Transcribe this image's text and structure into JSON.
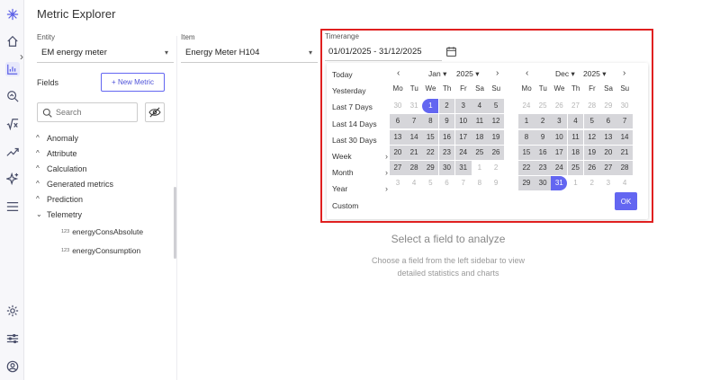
{
  "app": {
    "title": "Metric Explorer"
  },
  "entity": {
    "label": "Entity",
    "value": "EM energy meter"
  },
  "item": {
    "label": "Item",
    "value": "Energy Meter H104"
  },
  "fields": {
    "title": "Fields",
    "new_metric_label": "+ New Metric",
    "search_placeholder": "Search",
    "groups": [
      {
        "label": "Anomaly"
      },
      {
        "label": "Attribute"
      },
      {
        "label": "Calculation"
      },
      {
        "label": "Generated metrics"
      },
      {
        "label": "Prediction"
      },
      {
        "label": "Telemetry"
      }
    ],
    "telemetry_children": [
      {
        "prefix": "123",
        "label": "energyConsAbsolute"
      },
      {
        "prefix": "123",
        "label": "energyConsumption"
      }
    ]
  },
  "empty_state": {
    "title": "Select a field to analyze",
    "subtitle_line1": "Choose a field from the left sidebar to view",
    "subtitle_line2": "detailed statistics and charts"
  },
  "timerange": {
    "label": "Timerange",
    "value": "01/01/2025 - 31/12/2025",
    "presets": [
      {
        "label": "Today",
        "has_arrow": false
      },
      {
        "label": "Yesterday",
        "has_arrow": false
      },
      {
        "label": "Last 7 Days",
        "has_arrow": false
      },
      {
        "label": "Last 14 Days",
        "has_arrow": false
      },
      {
        "label": "Last 30 Days",
        "has_arrow": false
      },
      {
        "label": "Week",
        "has_arrow": true
      },
      {
        "label": "Month",
        "has_arrow": true
      },
      {
        "label": "Year",
        "has_arrow": true
      },
      {
        "label": "Custom",
        "has_arrow": false
      }
    ],
    "weekdays": [
      "Mo",
      "Tu",
      "We",
      "Th",
      "Fr",
      "Sa",
      "Su"
    ],
    "months": [
      {
        "month": "Jan",
        "year": "2025",
        "days": [
          {
            "d": "30",
            "s": "out"
          },
          {
            "d": "31",
            "s": "out"
          },
          {
            "d": "1",
            "s": "start"
          },
          {
            "d": "2",
            "s": "in"
          },
          {
            "d": "3",
            "s": "in"
          },
          {
            "d": "4",
            "s": "in"
          },
          {
            "d": "5",
            "s": "in"
          },
          {
            "d": "6",
            "s": "in"
          },
          {
            "d": "7",
            "s": "in"
          },
          {
            "d": "8",
            "s": "in"
          },
          {
            "d": "9",
            "s": "in"
          },
          {
            "d": "10",
            "s": "in"
          },
          {
            "d": "11",
            "s": "in"
          },
          {
            "d": "12",
            "s": "in"
          },
          {
            "d": "13",
            "s": "in"
          },
          {
            "d": "14",
            "s": "in"
          },
          {
            "d": "15",
            "s": "in"
          },
          {
            "d": "16",
            "s": "in"
          },
          {
            "d": "17",
            "s": "in"
          },
          {
            "d": "18",
            "s": "in"
          },
          {
            "d": "19",
            "s": "in"
          },
          {
            "d": "20",
            "s": "in"
          },
          {
            "d": "21",
            "s": "in"
          },
          {
            "d": "22",
            "s": "in"
          },
          {
            "d": "23",
            "s": "in"
          },
          {
            "d": "24",
            "s": "in"
          },
          {
            "d": "25",
            "s": "in"
          },
          {
            "d": "26",
            "s": "in"
          },
          {
            "d": "27",
            "s": "in"
          },
          {
            "d": "28",
            "s": "in"
          },
          {
            "d": "29",
            "s": "in"
          },
          {
            "d": "30",
            "s": "in"
          },
          {
            "d": "31",
            "s": "in"
          },
          {
            "d": "1",
            "s": "out"
          },
          {
            "d": "2",
            "s": "out"
          },
          {
            "d": "3",
            "s": "out"
          },
          {
            "d": "4",
            "s": "out"
          },
          {
            "d": "5",
            "s": "out"
          },
          {
            "d": "6",
            "s": "out"
          },
          {
            "d": "7",
            "s": "out"
          },
          {
            "d": "8",
            "s": "out"
          },
          {
            "d": "9",
            "s": "out"
          }
        ]
      },
      {
        "month": "Dec",
        "year": "2025",
        "days": [
          {
            "d": "24",
            "s": "out"
          },
          {
            "d": "25",
            "s": "out"
          },
          {
            "d": "26",
            "s": "out"
          },
          {
            "d": "27",
            "s": "out"
          },
          {
            "d": "28",
            "s": "out"
          },
          {
            "d": "29",
            "s": "out"
          },
          {
            "d": "30",
            "s": "out"
          },
          {
            "d": "1",
            "s": "in"
          },
          {
            "d": "2",
            "s": "in"
          },
          {
            "d": "3",
            "s": "in"
          },
          {
            "d": "4",
            "s": "in"
          },
          {
            "d": "5",
            "s": "in"
          },
          {
            "d": "6",
            "s": "in"
          },
          {
            "d": "7",
            "s": "in"
          },
          {
            "d": "8",
            "s": "in"
          },
          {
            "d": "9",
            "s": "in"
          },
          {
            "d": "10",
            "s": "in"
          },
          {
            "d": "11",
            "s": "in"
          },
          {
            "d": "12",
            "s": "in"
          },
          {
            "d": "13",
            "s": "in"
          },
          {
            "d": "14",
            "s": "in"
          },
          {
            "d": "15",
            "s": "in"
          },
          {
            "d": "16",
            "s": "in"
          },
          {
            "d": "17",
            "s": "in"
          },
          {
            "d": "18",
            "s": "in"
          },
          {
            "d": "19",
            "s": "in"
          },
          {
            "d": "20",
            "s": "in"
          },
          {
            "d": "21",
            "s": "in"
          },
          {
            "d": "22",
            "s": "in"
          },
          {
            "d": "23",
            "s": "in"
          },
          {
            "d": "24",
            "s": "in"
          },
          {
            "d": "25",
            "s": "in"
          },
          {
            "d": "26",
            "s": "in"
          },
          {
            "d": "27",
            "s": "in"
          },
          {
            "d": "28",
            "s": "in"
          },
          {
            "d": "29",
            "s": "in"
          },
          {
            "d": "30",
            "s": "in"
          },
          {
            "d": "31",
            "s": "end"
          },
          {
            "d": "1",
            "s": "out"
          },
          {
            "d": "2",
            "s": "out"
          },
          {
            "d": "3",
            "s": "out"
          },
          {
            "d": "4",
            "s": "out"
          }
        ]
      }
    ],
    "ok_label": "OK"
  },
  "colors": {
    "accent": "#6366f1",
    "range_fill": "#d6d6da",
    "highlight": "#e02020"
  },
  "rail_icons": [
    "logo-icon",
    "home-icon",
    "chart-icon",
    "search-chart-icon",
    "formula-icon",
    "trend-icon",
    "sparkle-icon",
    "menu-icon",
    "settings-icon",
    "sliders-icon",
    "user-icon"
  ]
}
